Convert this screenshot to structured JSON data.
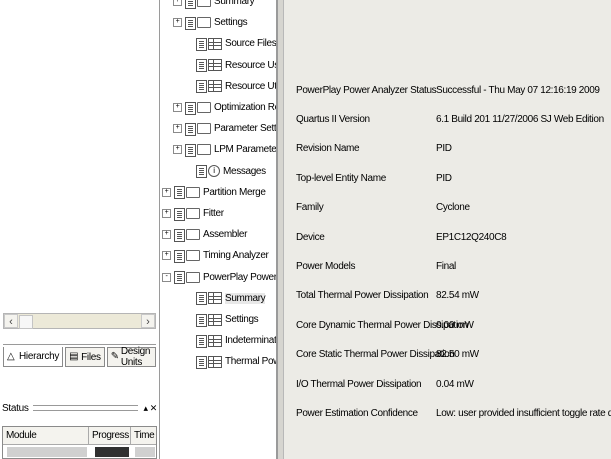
{
  "navigator": {
    "tabs": [
      {
        "label": "Hierarchy",
        "icon": "hierarchy-icon"
      },
      {
        "label": "Files",
        "icon": "files-icon"
      },
      {
        "label": "Design Units",
        "icon": "design-units-icon"
      }
    ]
  },
  "status": {
    "title": "Status",
    "columns": [
      "Module",
      "Progress %",
      "Time"
    ]
  },
  "tree": {
    "items": [
      {
        "label": "Summary",
        "icon": "report-folder-icon",
        "expander": "+"
      },
      {
        "label": "Settings",
        "icon": "report-folder-icon",
        "expander": "+"
      },
      {
        "label": "Source Files Read",
        "icon": "report-table-icon",
        "expander": ""
      },
      {
        "label": "Resource Usage Summ",
        "icon": "report-table-icon",
        "expander": ""
      },
      {
        "label": "Resource Utilization by",
        "icon": "report-table-icon",
        "expander": ""
      },
      {
        "label": "Optimization Results",
        "icon": "report-folder-icon",
        "expander": "+"
      },
      {
        "label": "Parameter Settings by",
        "icon": "report-folder-icon",
        "expander": "+"
      },
      {
        "label": "LPM Parameter Setting",
        "icon": "report-folder-icon",
        "expander": "+"
      },
      {
        "label": "Messages",
        "icon": "report-messages-icon",
        "expander": ""
      },
      {
        "label": "Partition Merge",
        "icon": "report-folder-icon",
        "expander": "+"
      },
      {
        "label": "Fitter",
        "icon": "report-folder-icon",
        "expander": "+"
      },
      {
        "label": "Assembler",
        "icon": "report-folder-icon",
        "expander": "+"
      },
      {
        "label": "Timing Analyzer",
        "icon": "report-folder-icon",
        "expander": "+"
      },
      {
        "label": "PowerPlay Power Analyzer",
        "icon": "report-folder-icon",
        "expander": "-"
      },
      {
        "label": "Summary",
        "icon": "report-table-icon",
        "expander": ""
      },
      {
        "label": "Settings",
        "icon": "report-table-icon",
        "expander": ""
      },
      {
        "label": "Indeterminate Toggle R",
        "icon": "report-table-icon",
        "expander": ""
      },
      {
        "label": "Thermal Power Dissipat",
        "icon": "report-table-icon",
        "expander": ""
      }
    ]
  },
  "summary": {
    "rows": [
      {
        "key": "PowerPlay Power Analyzer Status",
        "value": "Successful - Thu May 07 12:16:19 2009"
      },
      {
        "key": "Quartus II Version",
        "value": "6.1 Build 201 11/27/2006 SJ Web Edition"
      },
      {
        "key": "Revision Name",
        "value": "PID"
      },
      {
        "key": "Top-level Entity Name",
        "value": "PID"
      },
      {
        "key": "Family",
        "value": "Cyclone"
      },
      {
        "key": "Device",
        "value": "EP1C12Q240C8"
      },
      {
        "key": "Power Models",
        "value": "Final"
      },
      {
        "key": "Total Thermal Power Dissipation",
        "value": "82.54 mW"
      },
      {
        "key": "Core Dynamic Thermal Power Dissipation",
        "value": "0.00 mW"
      },
      {
        "key": "Core Static Thermal Power Dissipation",
        "value": "82.50 mW"
      },
      {
        "key": "I/O Thermal Power Dissipation",
        "value": "0.04 mW"
      },
      {
        "key": "Power Estimation Confidence",
        "value": "Low: user provided insufficient toggle rate data"
      }
    ]
  }
}
